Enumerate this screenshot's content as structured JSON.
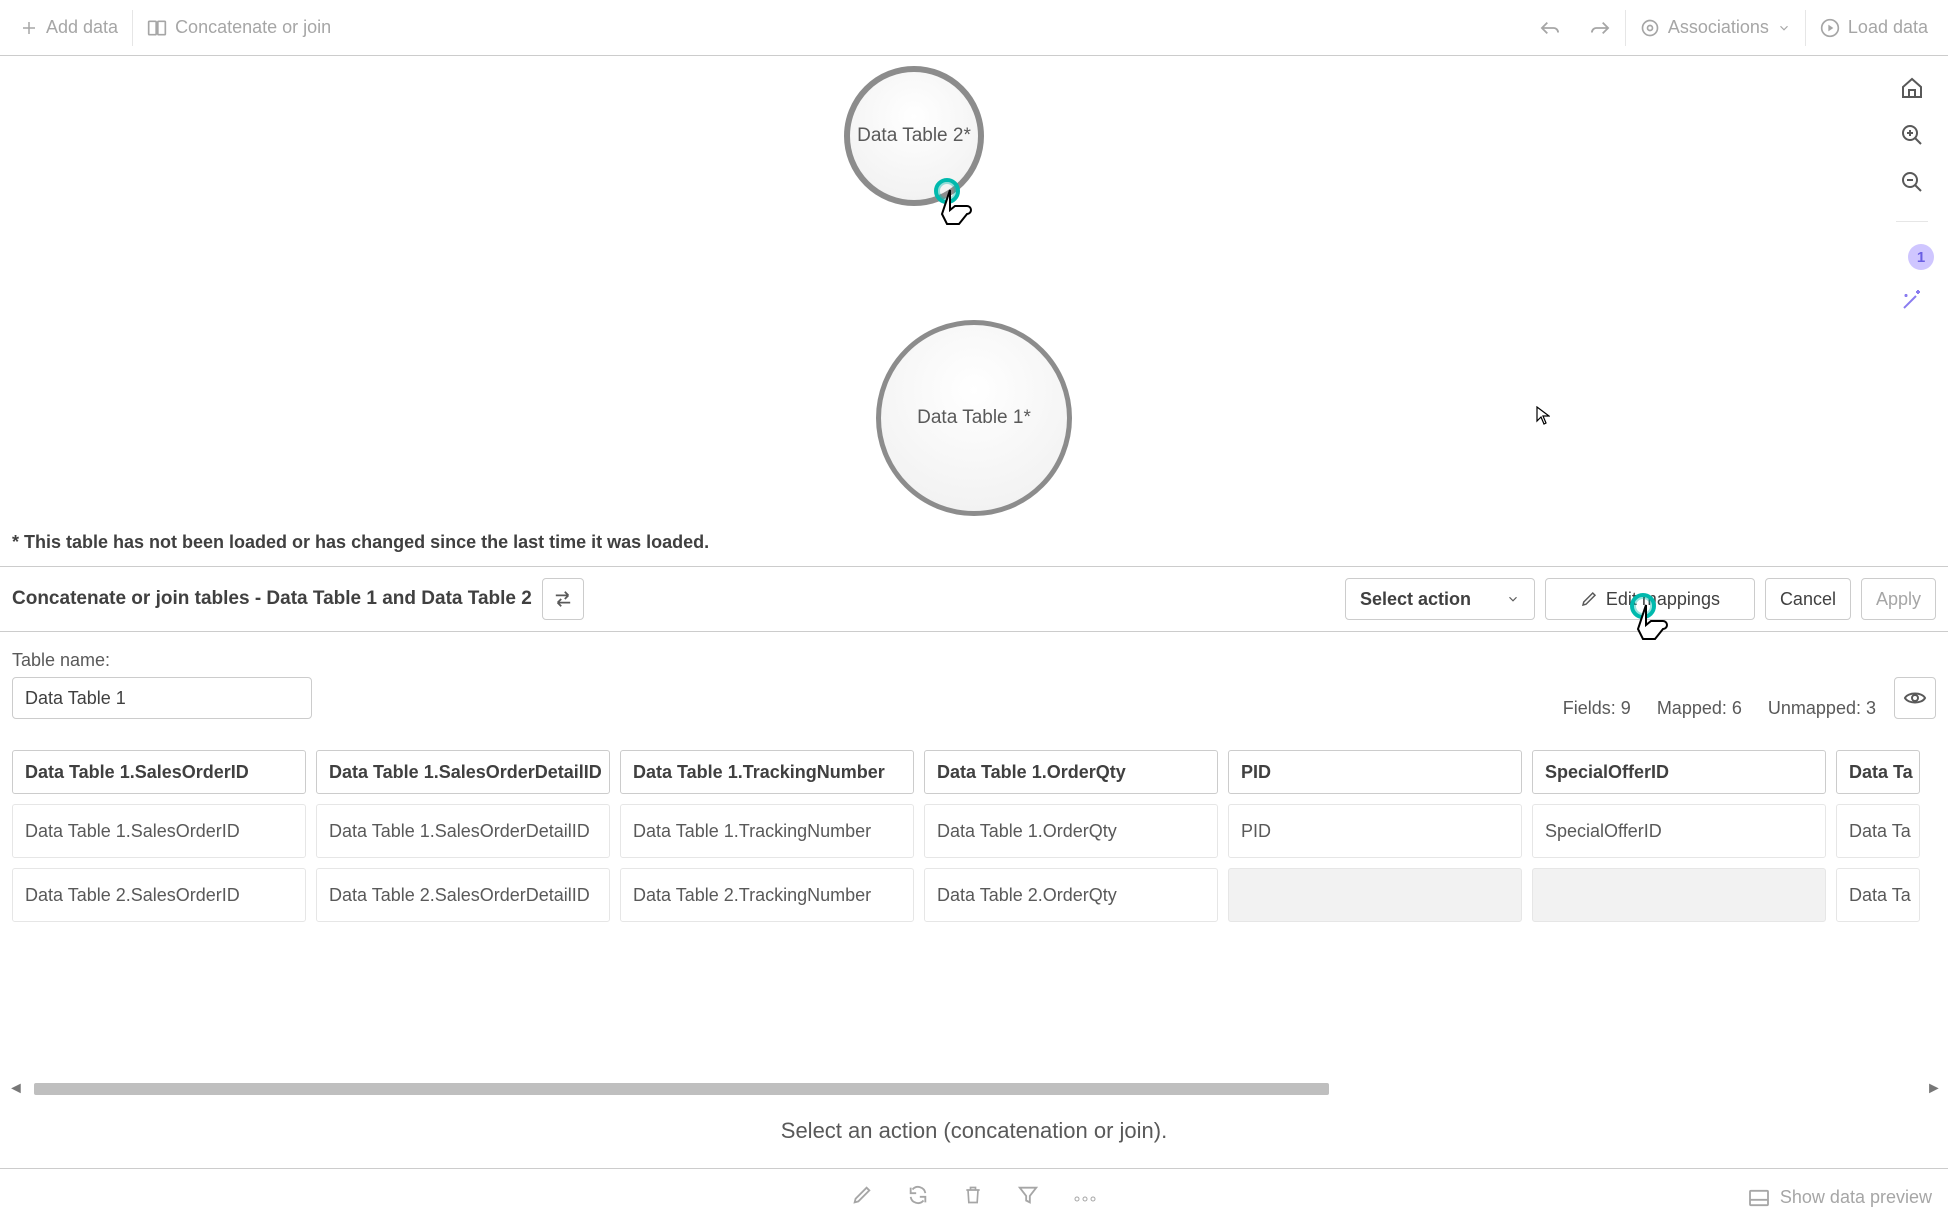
{
  "topbar": {
    "add_data": "Add data",
    "concat_join": "Concatenate or join",
    "associations": "Associations",
    "load_data": "Load data"
  },
  "side": {
    "badge": "1"
  },
  "canvas": {
    "bubble_small": "Data Table 2*",
    "bubble_large": "Data Table 1*",
    "note": "* This table has not been loaded or has changed since the last time it was loaded."
  },
  "actionbar": {
    "title": "Concatenate or join tables - Data Table 1 and Data Table 2",
    "select_action": "Select action",
    "edit_mappings": "Edit mappings",
    "cancel": "Cancel",
    "apply": "Apply"
  },
  "tablename": {
    "label": "Table name:",
    "value": "Data Table 1"
  },
  "stats": {
    "fields_label": "Fields:",
    "fields_val": "9",
    "mapped_label": "Mapped:",
    "mapped_val": "6",
    "unmapped_label": "Unmapped:",
    "unmapped_val": "3"
  },
  "columns": [
    {
      "header": "Data Table 1.SalesOrderID",
      "rows": [
        "Data Table 1.SalesOrderID",
        "Data Table 2.SalesOrderID"
      ]
    },
    {
      "header": "Data Table 1.SalesOrderDetailID",
      "rows": [
        "Data Table 1.SalesOrderDetailID",
        "Data Table 2.SalesOrderDetailID"
      ]
    },
    {
      "header": "Data Table 1.TrackingNumber",
      "rows": [
        "Data Table 1.TrackingNumber",
        "Data Table 2.TrackingNumber"
      ]
    },
    {
      "header": "Data Table 1.OrderQty",
      "rows": [
        "Data Table 1.OrderQty",
        "Data Table 2.OrderQty"
      ]
    },
    {
      "header": "PID",
      "rows": [
        "PID",
        ""
      ]
    },
    {
      "header": "SpecialOfferID",
      "rows": [
        "SpecialOfferID",
        ""
      ]
    },
    {
      "header": "Data Ta",
      "rows": [
        "Data Ta",
        "Data Ta"
      ]
    }
  ],
  "hint": "Select an action (concatenation or join).",
  "bottom": {
    "preview": "Show data preview"
  }
}
